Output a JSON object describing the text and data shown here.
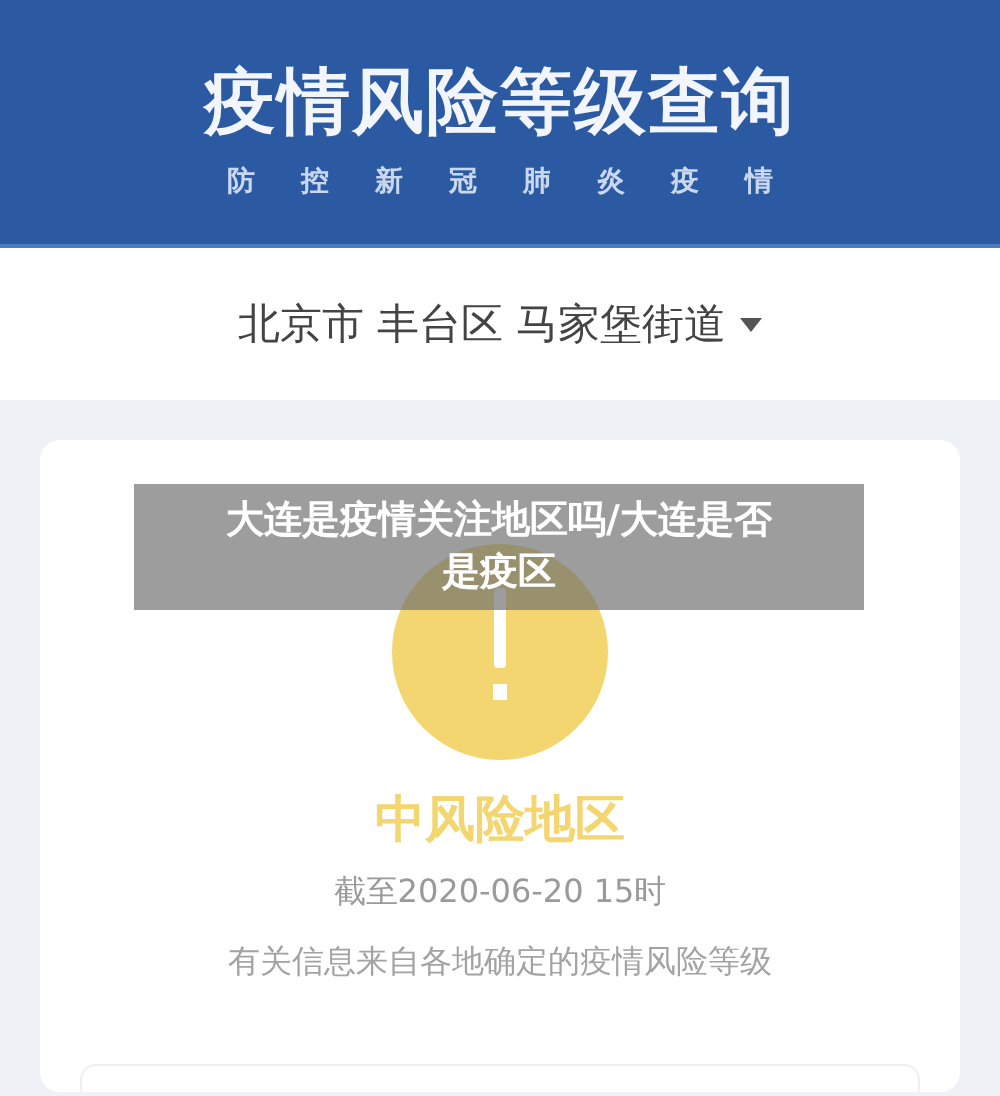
{
  "header": {
    "title": "疫情风险等级查询",
    "subtitle": [
      "防",
      "控",
      "新",
      "冠",
      "肺",
      "炎",
      "疫",
      "情"
    ]
  },
  "location": {
    "city": "北京市",
    "district": "丰台区",
    "street": "马家堡街道"
  },
  "result": {
    "color": "#f3d66f",
    "risk_label": "中风险地区",
    "as_of": "截至2020-06-20 15时",
    "note": "有关信息来自各地确定的疫情风险等级"
  },
  "overlay_caption": "大连是疫情关注地区吗/大连是否是疫区"
}
